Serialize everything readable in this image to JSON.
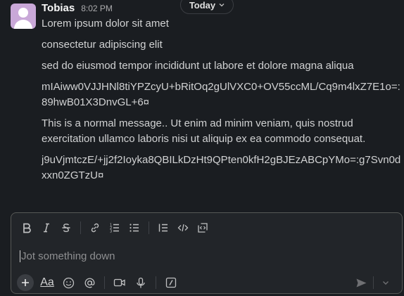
{
  "message": {
    "sender": "Tobias",
    "time": "8:02 PM",
    "lines": [
      "Lorem ipsum dolor sit amet",
      "consectetur adipiscing elit",
      "sed do eiusmod tempor incididunt ut labore et dolore magna aliqua",
      "mIAiww0VJJHNl8tiYPZcyU+bRitOq2gUlVXC0+OV55ccML/Cq9m4lxZ7E1o=:89hwB01X3DnvGL+6¤",
      "This is a normal message.. Ut enim ad minim veniam, quis nostrud exercitation ullamco laboris nisi ut aliquip ex ea commodo consequat.",
      "j9uVjmtczE/+jj2f2Ioyka8QBILkDzHt9QPten0kfH2gBJEzABCpYMo=:g7Svn0dxxn0ZGTzU¤"
    ]
  },
  "day_divider": {
    "label": "Today"
  },
  "composer": {
    "placeholder": "Jot something down",
    "toolbar_icons": [
      "bold-icon",
      "italic-icon",
      "strikethrough-icon",
      "link-icon",
      "ordered-list-icon",
      "bullet-list-icon",
      "blockquote-icon",
      "code-icon",
      "code-block-icon"
    ],
    "bottom_icons": [
      "plus-icon",
      "text-format-icon",
      "emoji-icon",
      "mention-icon",
      "video-icon",
      "microphone-icon",
      "slash-command-icon"
    ],
    "text_format_label": "Aa"
  },
  "colors": {
    "background": "#1a1d21",
    "composer_background": "#222529",
    "text": "#d1d2d3",
    "avatar": "#c9a8d8"
  }
}
